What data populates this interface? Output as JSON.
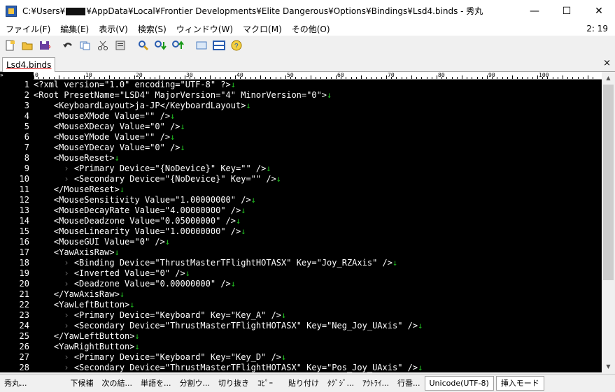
{
  "window": {
    "title_prefix": "C:¥Users¥",
    "title_suffix": "¥AppData¥Local¥Frontier Developments¥Elite Dangerous¥Options¥Bindings¥Lsd4.binds  - 秀丸",
    "minimize": "—",
    "maximize": "☐",
    "close": "✕"
  },
  "menu": {
    "items": [
      "ファイル(F)",
      "編集(E)",
      "表示(V)",
      "検索(S)",
      "ウィンドウ(W)",
      "マクロ(M)",
      "その他(O)"
    ],
    "clock": "2: 19"
  },
  "toolbar": {
    "icons": [
      "new-file-icon",
      "open-folder-icon",
      "save-icon",
      "undo-icon",
      "copy-icon",
      "cut-icon",
      "paste-icon",
      "search-icon",
      "search-down-icon",
      "search-up-icon",
      "window-icon",
      "split-icon",
      "help-icon"
    ]
  },
  "tab": {
    "label": "Lsd4.binds",
    "close": "×"
  },
  "gutter": {
    "marker": "»"
  },
  "ruler": {
    "labels": [
      "0",
      "10",
      "20",
      "30",
      "40",
      "50",
      "60",
      "70",
      "80",
      "90",
      "100"
    ]
  },
  "lines": [
    {
      "n": "1",
      "indent": 0,
      "text": "<?xml version=\"1.0\" encoding=\"UTF-8\" ?>"
    },
    {
      "n": "2",
      "indent": 0,
      "text": "<Root PresetName=\"LSD4\" MajorVersion=\"4\" MinorVersion=\"0\">"
    },
    {
      "n": "3",
      "indent": 1,
      "text": "<KeyboardLayout>ja-JP</KeyboardLayout>"
    },
    {
      "n": "4",
      "indent": 1,
      "text": "<MouseXMode Value=\"\" />"
    },
    {
      "n": "5",
      "indent": 1,
      "text": "<MouseXDecay Value=\"0\" />"
    },
    {
      "n": "6",
      "indent": 1,
      "text": "<MouseYMode Value=\"\" />"
    },
    {
      "n": "7",
      "indent": 1,
      "text": "<MouseYDecay Value=\"0\" />"
    },
    {
      "n": "8",
      "indent": 1,
      "text": "<MouseReset>"
    },
    {
      "n": "9",
      "indent": 2,
      "text": "<Primary Device=\"{NoDevice}\" Key=\"\" />"
    },
    {
      "n": "10",
      "indent": 2,
      "text": "<Secondary Device=\"{NoDevice}\" Key=\"\" />"
    },
    {
      "n": "11",
      "indent": 1,
      "text": "</MouseReset>"
    },
    {
      "n": "12",
      "indent": 1,
      "text": "<MouseSensitivity Value=\"1.00000000\" />"
    },
    {
      "n": "13",
      "indent": 1,
      "text": "<MouseDecayRate Value=\"4.00000000\" />"
    },
    {
      "n": "14",
      "indent": 1,
      "text": "<MouseDeadzone Value=\"0.05000000\" />"
    },
    {
      "n": "15",
      "indent": 1,
      "text": "<MouseLinearity Value=\"1.00000000\" />"
    },
    {
      "n": "16",
      "indent": 1,
      "text": "<MouseGUI Value=\"0\" />"
    },
    {
      "n": "17",
      "indent": 1,
      "text": "<YawAxisRaw>"
    },
    {
      "n": "18",
      "indent": 2,
      "text": "<Binding Device=\"ThrustMasterTFlightHOTASX\" Key=\"Joy_RZAxis\" />"
    },
    {
      "n": "19",
      "indent": 2,
      "text": "<Inverted Value=\"0\" />"
    },
    {
      "n": "20",
      "indent": 2,
      "text": "<Deadzone Value=\"0.00000000\" />"
    },
    {
      "n": "21",
      "indent": 1,
      "text": "</YawAxisRaw>"
    },
    {
      "n": "22",
      "indent": 1,
      "text": "<YawLeftButton>"
    },
    {
      "n": "23",
      "indent": 2,
      "text": "<Primary Device=\"Keyboard\" Key=\"Key_A\" />"
    },
    {
      "n": "24",
      "indent": 2,
      "text": "<Secondary Device=\"ThrustMasterTFlightHOTASX\" Key=\"Neg_Joy_UAxis\" />"
    },
    {
      "n": "25",
      "indent": 1,
      "text": "</YawLeftButton>"
    },
    {
      "n": "26",
      "indent": 1,
      "text": "<YawRightButton>"
    },
    {
      "n": "27",
      "indent": 2,
      "text": "<Primary Device=\"Keyboard\" Key=\"Key_D\" />"
    },
    {
      "n": "28",
      "indent": 2,
      "text": "<Secondary Device=\"ThrustMasterTFlightHOTASX\" Key=\"Pos_Joy_UAxis\" />"
    }
  ],
  "glyphs": {
    "newline": "↓",
    "tab": "›"
  },
  "status": {
    "items": [
      "秀丸...",
      "下候補",
      "次の結...",
      "単語を...",
      "分割ウ...",
      "切り抜き",
      "ｺﾋﾟｰ",
      "貼り付け",
      "ﾀｸﾞｼﾞ...",
      "ｱｳﾄﾗｲ...",
      "行番..."
    ],
    "encoding": "Unicode(UTF-8)",
    "mode": "挿入モード"
  }
}
